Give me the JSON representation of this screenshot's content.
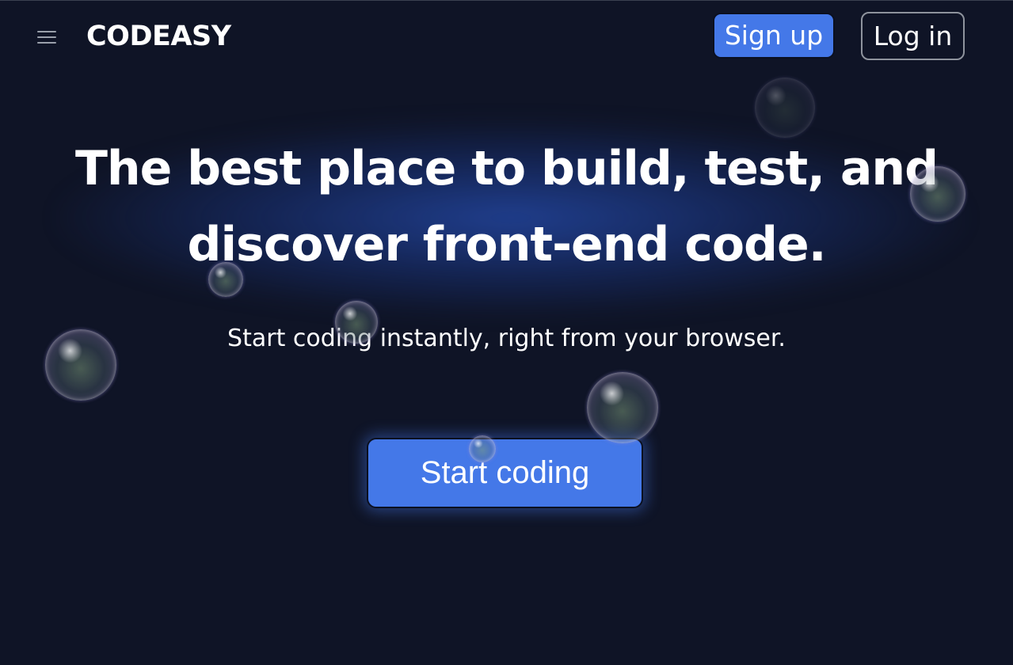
{
  "header": {
    "menu_icon": "hamburger-menu-icon",
    "logo": "CODEASY",
    "signup_label": "Sign up",
    "login_label": "Log in"
  },
  "hero": {
    "headline_line1": "The best place to build, test, and",
    "headline_line2": "discover front-end code.",
    "subheadline": "Start coding instantly, right from your browser.",
    "cta_label": "Start coding"
  },
  "decorations": {
    "bubble_icon": "bubble-icon"
  },
  "colors": {
    "background": "#0f1426",
    "accent": "#4478e8",
    "text": "#ffffff"
  }
}
